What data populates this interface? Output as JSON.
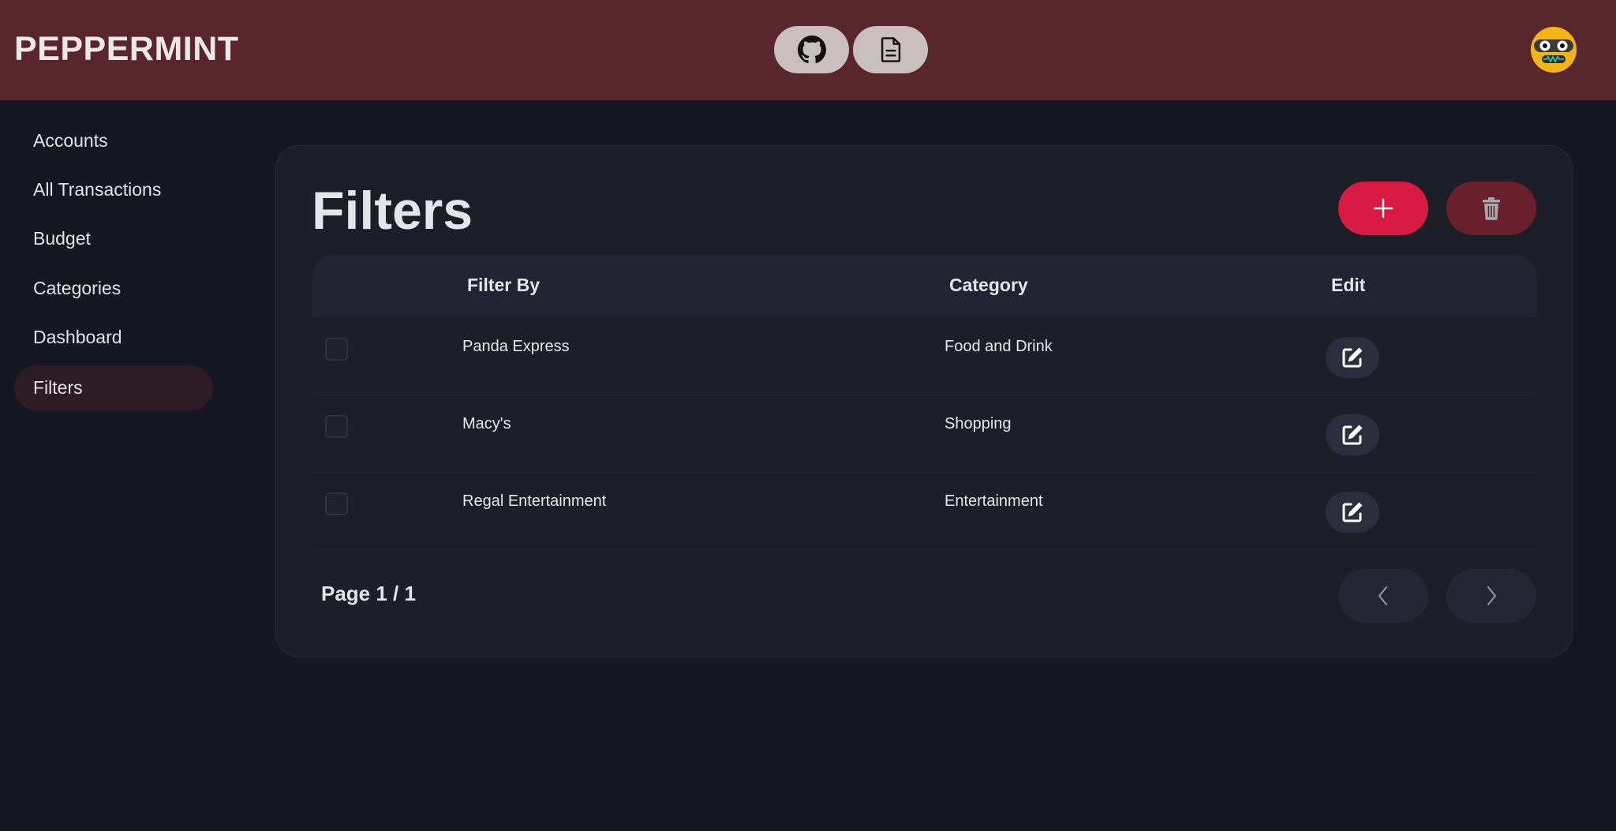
{
  "app": {
    "brand": "PEPPERMINT"
  },
  "header": {
    "buttons": [
      {
        "icon": "github-icon"
      },
      {
        "icon": "document-icon"
      }
    ],
    "avatar_icon": "robot-face-icon"
  },
  "sidebar": {
    "items": [
      {
        "label": "Accounts",
        "active": false
      },
      {
        "label": "All Transactions",
        "active": false
      },
      {
        "label": "Budget",
        "active": false
      },
      {
        "label": "Categories",
        "active": false
      },
      {
        "label": "Dashboard",
        "active": false
      },
      {
        "label": "Filters",
        "active": true
      }
    ]
  },
  "main": {
    "title": "Filters",
    "add_icon": "plus-icon",
    "delete_icon": "trash-icon",
    "table": {
      "headers": [
        "Filter By",
        "Category",
        "Edit"
      ],
      "rows": [
        {
          "filter_by": "Panda Express",
          "category": "Food and Drink",
          "checked": false
        },
        {
          "filter_by": "Macy's",
          "category": "Shopping",
          "checked": false
        },
        {
          "filter_by": "Regal Entertainment",
          "category": "Entertainment",
          "checked": false
        }
      ]
    },
    "pagination": {
      "label": "Page 1 / 1",
      "prev_icon": "chevron-left-icon",
      "next_icon": "chevron-right-icon"
    }
  },
  "colors": {
    "header_bg": "#5a262d",
    "page_bg": "#151820",
    "card_bg": "#1c1f28",
    "accent": "#d91a43",
    "delete_bg": "#6a1f2d",
    "active_nav_bg": "#2e1c24"
  }
}
